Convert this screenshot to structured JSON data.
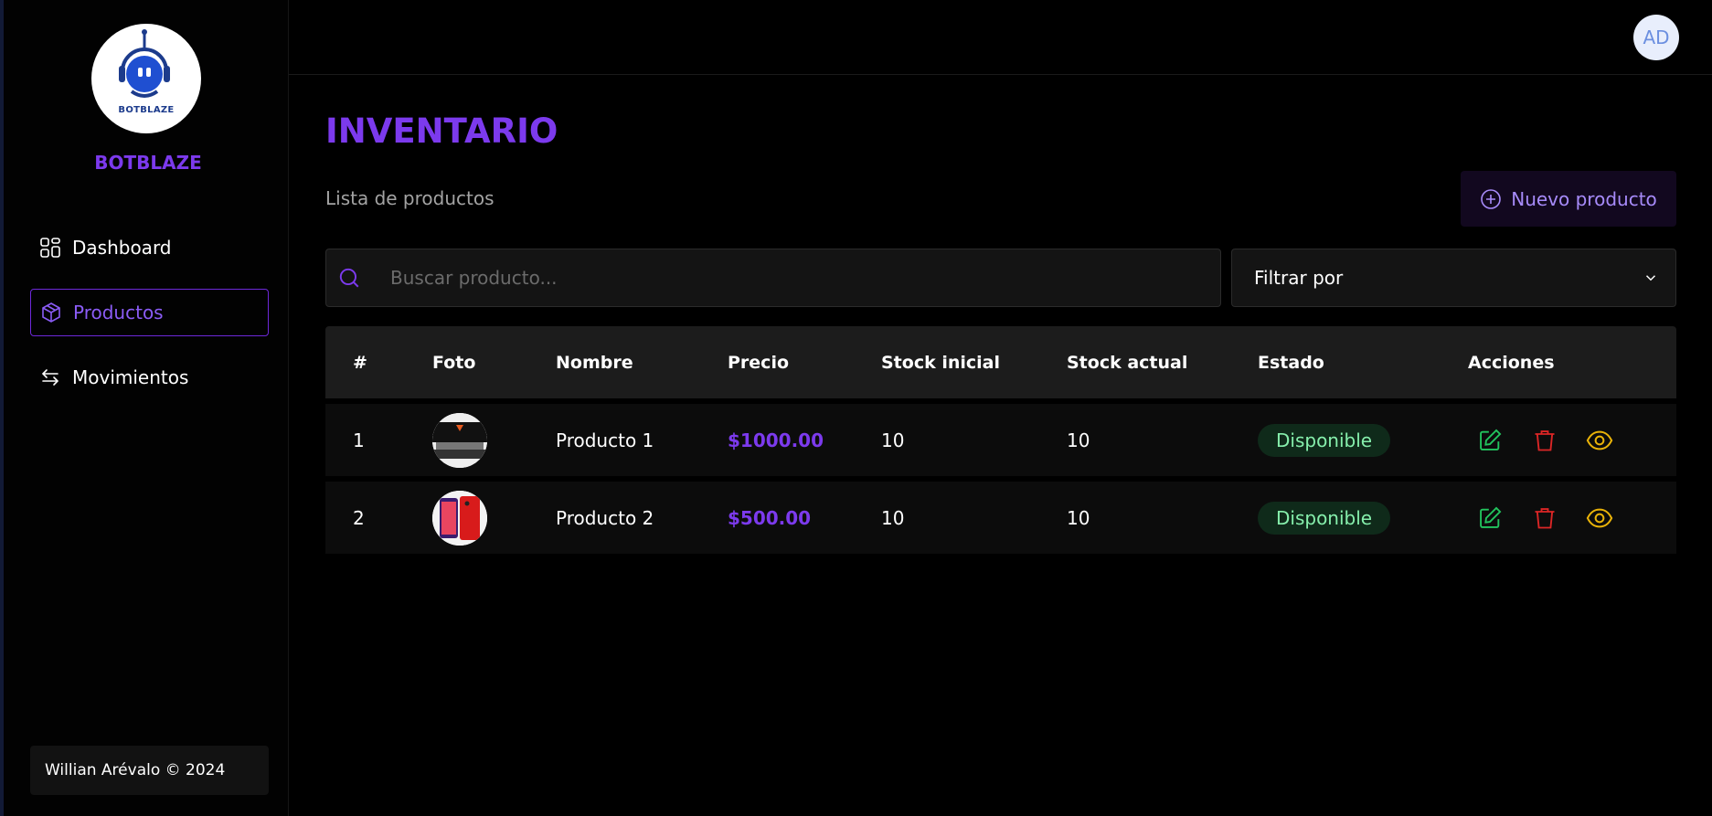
{
  "sidebar": {
    "logo_text": "BOTBLAZE",
    "brand": "BOTBLAZE",
    "items": [
      {
        "label": "Dashboard",
        "icon": "grid-icon"
      },
      {
        "label": "Productos",
        "icon": "box-icon"
      },
      {
        "label": "Movimientos",
        "icon": "swap-icon"
      }
    ],
    "footer": "Willian Arévalo © 2024"
  },
  "header": {
    "avatar_initials": "AD"
  },
  "main": {
    "title": "INVENTARIO",
    "subtitle": "Lista de productos",
    "new_button": "Nuevo producto",
    "search_placeholder": "Buscar producto...",
    "filter_label": "Filtrar por"
  },
  "table": {
    "headers": [
      "#",
      "Foto",
      "Nombre",
      "Precio",
      "Stock inicial",
      "Stock actual",
      "Estado",
      "Acciones"
    ],
    "rows": [
      {
        "id": "1",
        "name": "Producto 1",
        "price": "$1000.00",
        "stock_initial": "10",
        "stock_current": "10",
        "status": "Disponible"
      },
      {
        "id": "2",
        "name": "Producto 2",
        "price": "$500.00",
        "stock_initial": "10",
        "stock_current": "10",
        "status": "Disponible"
      }
    ]
  },
  "colors": {
    "accent": "#7c3aed",
    "edit": "#22c55e",
    "delete": "#dc2626",
    "view": "#eab308",
    "badge_text": "#86efac"
  }
}
